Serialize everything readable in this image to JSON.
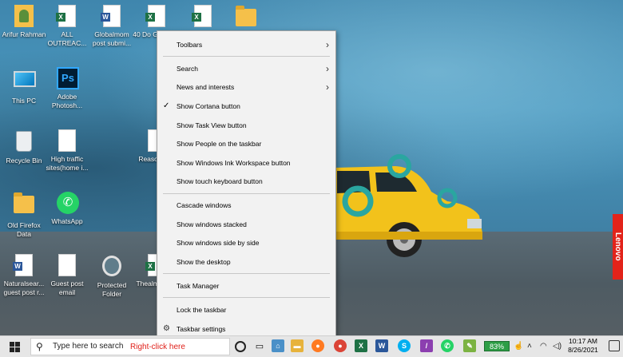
{
  "desktop": {
    "icons": [
      {
        "label": "Arifur Rahman"
      },
      {
        "label": "ALL OUTREAC..."
      },
      {
        "label": "Globalmom post submi..."
      },
      {
        "label": "40 Do Google..."
      },
      {
        "label": "This PC"
      },
      {
        "label": "Adobe Photosh..."
      },
      {
        "label": "Recycle Bin"
      },
      {
        "label": "High traffic sites(home i..."
      },
      {
        "label": "Reaso price"
      },
      {
        "label": "Old Firefox Data"
      },
      {
        "label": "WhatsApp"
      },
      {
        "label": "Naturalsear... guest post r..."
      },
      {
        "label": "Guest post email"
      },
      {
        "label": "Protected Folder"
      },
      {
        "label": "Thealm posts"
      }
    ],
    "brand_tag": "Lenovo"
  },
  "context_menu": {
    "items": [
      {
        "label": "Toolbars",
        "submenu": true
      },
      {
        "label": "Search",
        "submenu": true
      },
      {
        "label": "News and interests",
        "submenu": true
      },
      {
        "label": "Show Cortana button",
        "checked": true
      },
      {
        "label": "Show Task View button"
      },
      {
        "label": "Show People on the taskbar"
      },
      {
        "label": "Show Windows Ink Workspace button"
      },
      {
        "label": "Show touch keyboard button"
      },
      {
        "label": "Cascade windows"
      },
      {
        "label": "Show windows stacked"
      },
      {
        "label": "Show windows side by side"
      },
      {
        "label": "Show the desktop"
      },
      {
        "label": "Task Manager"
      },
      {
        "label": "Lock the taskbar"
      },
      {
        "label": "Taskbar settings",
        "icon": "gear-icon"
      }
    ],
    "check_glyph": "✓",
    "arrow_glyph": "›"
  },
  "taskbar": {
    "search_placeholder": "Type here to search",
    "annotation": "Right-click here",
    "battery": "83%",
    "time": "10:17 AM",
    "date": "8/26/2021"
  },
  "colors": {
    "menu_bg": "#f2f2f2",
    "taskbar_bg": "#e6e6e6",
    "annotation_red": "#e0201a",
    "battery_green": "#2e9e46",
    "car_yellow": "#f2c21b"
  }
}
